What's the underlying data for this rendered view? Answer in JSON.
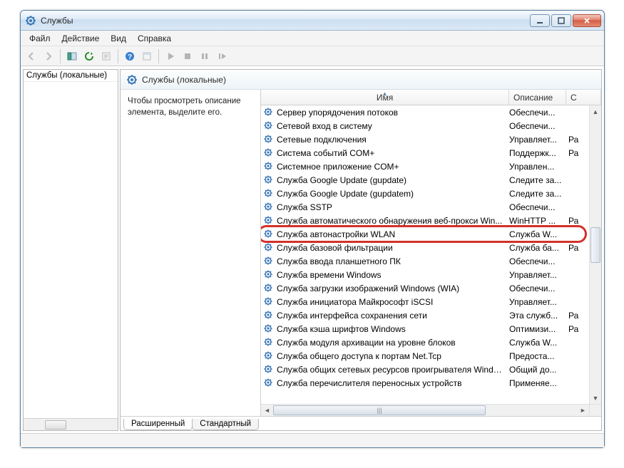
{
  "window": {
    "title": "Службы"
  },
  "menu": {
    "file": "Файл",
    "action": "Действие",
    "view": "Вид",
    "help": "Справка"
  },
  "leftpane": {
    "label": "Службы (локальные)"
  },
  "rightpane": {
    "heading": "Службы (локальные)",
    "desc": "Чтобы просмотреть описание элемента, выделите его."
  },
  "columns": {
    "name": "Имя",
    "desc": "Описание",
    "status": "С"
  },
  "services": [
    {
      "name": "Сервер упорядочения потоков",
      "desc": "Обеспечи...",
      "status": ""
    },
    {
      "name": "Сетевой вход в систему",
      "desc": "Обеспечи...",
      "status": ""
    },
    {
      "name": "Сетевые подключения",
      "desc": "Управляет...",
      "status": "Ра"
    },
    {
      "name": "Система событий COM+",
      "desc": "Поддержк...",
      "status": "Ра"
    },
    {
      "name": "Системное приложение COM+",
      "desc": "Управлен...",
      "status": ""
    },
    {
      "name": "Служба Google Update (gupdate)",
      "desc": "Следите за...",
      "status": ""
    },
    {
      "name": "Служба Google Update (gupdatem)",
      "desc": "Следите за...",
      "status": ""
    },
    {
      "name": "Служба SSTP",
      "desc": "Обеспечи...",
      "status": ""
    },
    {
      "name": "Служба автоматического обнаружения веб-прокси Win...",
      "desc": "WinHTTP ...",
      "status": "Ра"
    },
    {
      "name": "Служба автонастройки WLAN",
      "desc": "Служба W...",
      "status": ""
    },
    {
      "name": "Служба базовой фильтрации",
      "desc": "Служба ба...",
      "status": "Ра"
    },
    {
      "name": "Служба ввода планшетного ПК",
      "desc": "Обеспечи...",
      "status": ""
    },
    {
      "name": "Служба времени Windows",
      "desc": "Управляет...",
      "status": ""
    },
    {
      "name": "Служба загрузки изображений Windows (WIA)",
      "desc": "Обеспечи...",
      "status": ""
    },
    {
      "name": "Служба инициатора Майкрософт iSCSI",
      "desc": "Управляет...",
      "status": ""
    },
    {
      "name": "Служба интерфейса сохранения сети",
      "desc": "Эта служб...",
      "status": "Ра"
    },
    {
      "name": "Служба кэша шрифтов Windows",
      "desc": "Оптимизи...",
      "status": "Ра"
    },
    {
      "name": "Служба модуля архивации на уровне блоков",
      "desc": "Служба W...",
      "status": ""
    },
    {
      "name": "Служба общего доступа к портам Net.Tcp",
      "desc": "Предоста...",
      "status": ""
    },
    {
      "name": "Служба общих сетевых ресурсов проигрывателя Window...",
      "desc": "Общий до...",
      "status": ""
    },
    {
      "name": "Служба перечислителя переносных устройств",
      "desc": "Применяе...",
      "status": ""
    }
  ],
  "highlighted_index": 9,
  "tabs": {
    "extended": "Расширенный",
    "standard": "Стандартный",
    "active": "extended"
  },
  "scroll": {
    "h_thumb": "|||"
  }
}
